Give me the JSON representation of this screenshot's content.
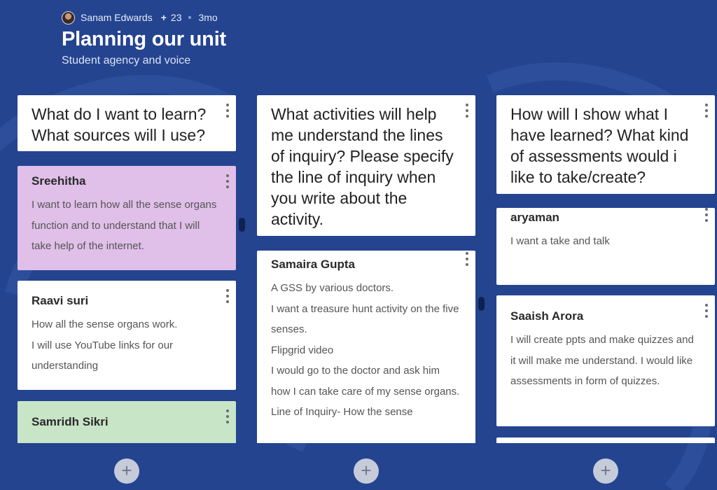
{
  "header": {
    "author": "Sanam Edwards",
    "plus": "+",
    "contributors": "23",
    "age": "3mo",
    "title": "Planning our unit",
    "subtitle": "Student agency and voice"
  },
  "columns": [
    {
      "title": "What do I want to learn? What sources will I use?",
      "posts": [
        {
          "author": "Sreehitha",
          "body": "I want to learn how all the sense organs function and to understand that I will take help of the internet.",
          "color": "#e0bfe9"
        },
        {
          "author": "Raavi suri",
          "body": "How all the sense organs work.\nI will use YouTube links for our understanding",
          "color": "#ffffff"
        },
        {
          "author": "Samridh Sikri",
          "body": "",
          "color": "#c9e5c8"
        }
      ]
    },
    {
      "title": "What activities will help me understand the lines of inquiry? Please specify the line of inquiry when you write about the activity.",
      "posts": [
        {
          "author": "Samaira Gupta",
          "body": "A GSS by various doctors.\nI want a treasure hunt activity on the five senses.\nFlipgrid video\nI would go to the doctor and ask him how I can take care of my sense organs.\nLine of Inquiry- How the sense",
          "color": "#ffffff"
        }
      ]
    },
    {
      "title": "How will I show what I have learned? What kind of assessments would i like to take/create?",
      "posts": [
        {
          "author": "aryaman",
          "body": "I want a take and talk",
          "color": "#ffffff"
        },
        {
          "author": "Saaish Arora",
          "body": "I will create ppts and make quizzes and it will make me understand. I would like assessments in form of quizzes.",
          "color": "#ffffff"
        }
      ]
    }
  ],
  "add_button_label": "+",
  "icons": {
    "more": "more-vert-icon",
    "add": "plus-icon"
  },
  "colors": {
    "background": "#244490",
    "accent_purple": "#e0bfe9",
    "accent_green": "#c9e5c8"
  }
}
